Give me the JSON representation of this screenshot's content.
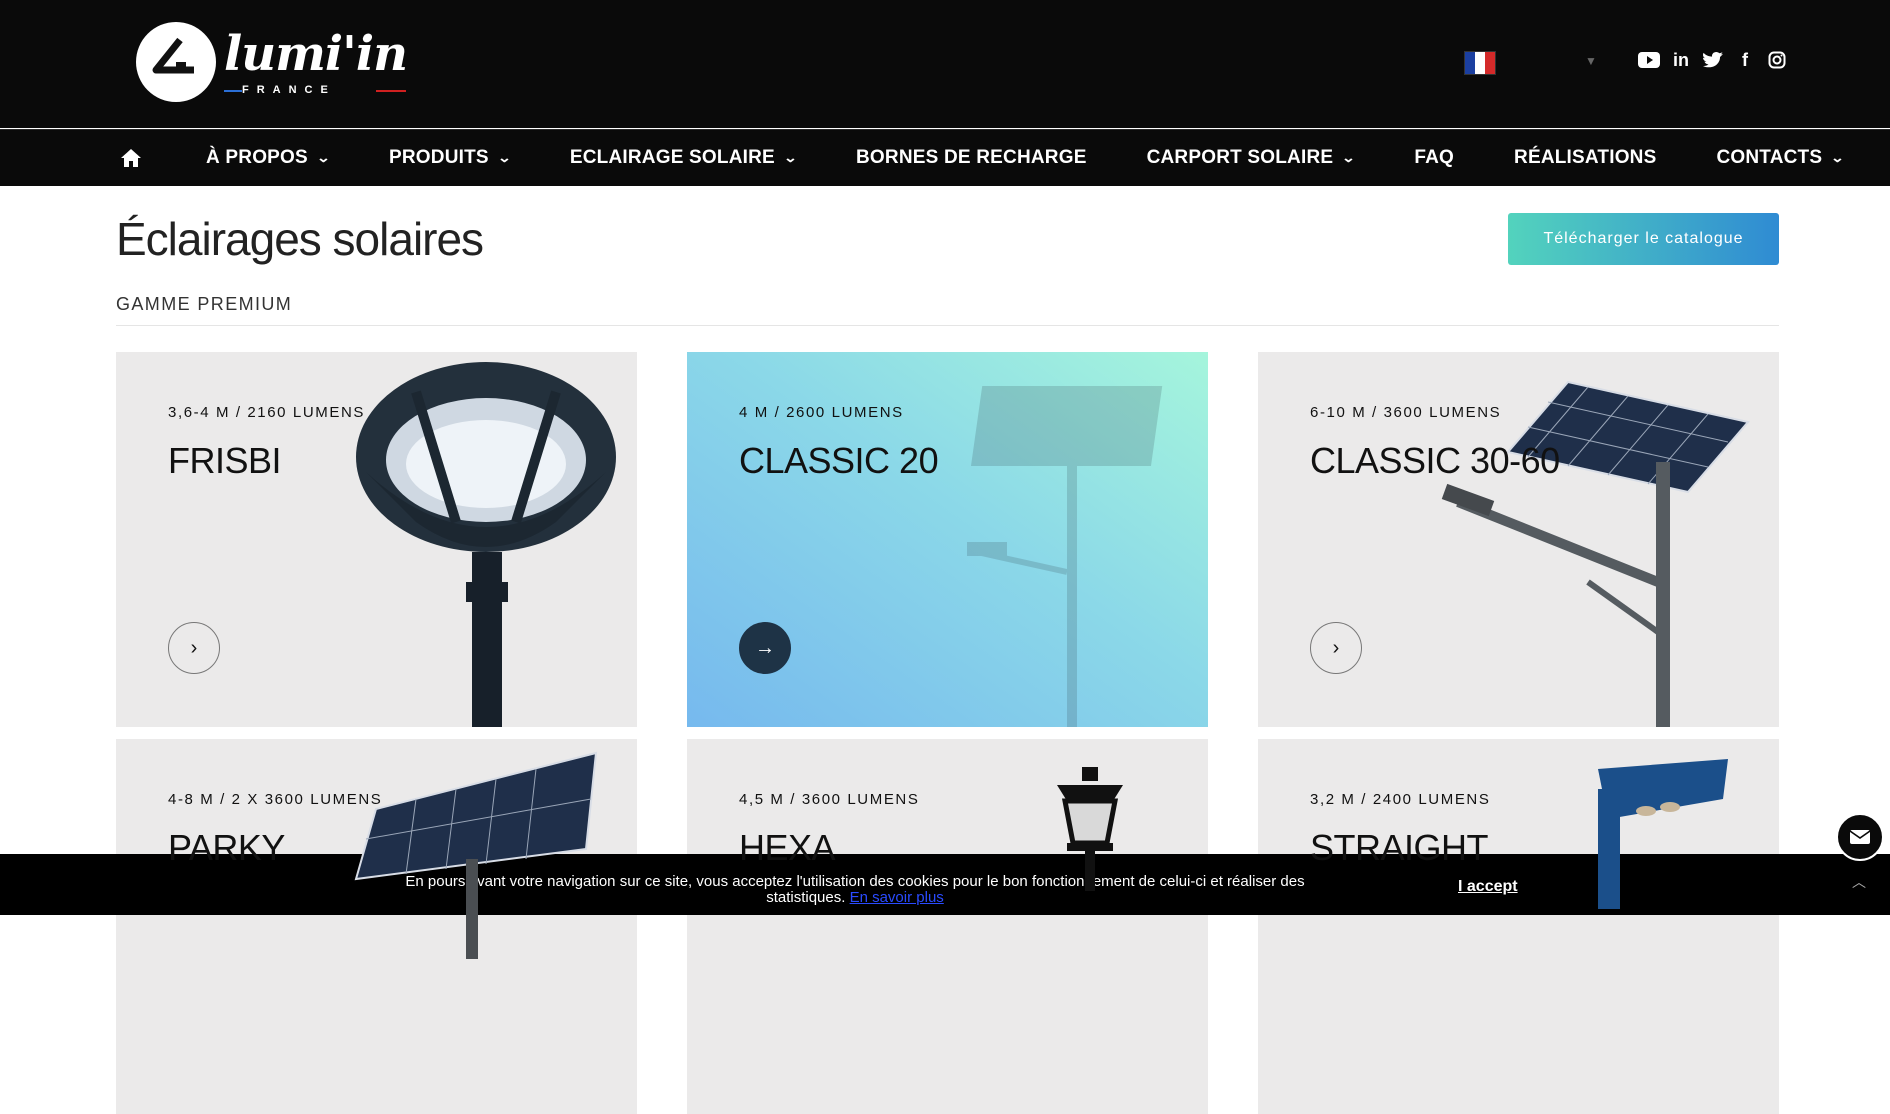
{
  "header": {
    "logo_text": "lumi'in",
    "logo_sub": "FRANCE",
    "language": "FR",
    "social_icons": [
      "youtube-icon",
      "linkedin-icon",
      "twitter-icon",
      "facebook-icon",
      "instagram-icon"
    ]
  },
  "nav": {
    "items": [
      {
        "label": "À PROPOS",
        "dropdown": true
      },
      {
        "label": "PRODUITS",
        "dropdown": true
      },
      {
        "label": "ECLAIRAGE SOLAIRE",
        "dropdown": true
      },
      {
        "label": "BORNES DE RECHARGE",
        "dropdown": false
      },
      {
        "label": "CARPORT SOLAIRE",
        "dropdown": true
      },
      {
        "label": "FAQ",
        "dropdown": false
      },
      {
        "label": "RÉALISATIONS",
        "dropdown": false
      },
      {
        "label": "CONTACTS",
        "dropdown": true
      }
    ]
  },
  "page": {
    "title": "Éclairages solaires",
    "download_label": "Télécharger le catalogue",
    "section": "GAMME PREMIUM"
  },
  "products": [
    {
      "spec": "3,6-4 M / 2160 LUMENS",
      "name": "FRISBI"
    },
    {
      "spec": "4 M / 2600 LUMENS",
      "name": "CLASSIC 20"
    },
    {
      "spec": "6-10 M / 3600 LUMENS",
      "name": "CLASSIC 30-60"
    },
    {
      "spec": "4-8 M / 2 X 3600 LUMENS",
      "name": "PARKY"
    },
    {
      "spec": "4,5 M / 3600 LUMENS",
      "name": "HEXA"
    },
    {
      "spec": "3,2 M / 2400 LUMENS",
      "name": "STRAIGHT"
    }
  ],
  "cookie": {
    "text": "En poursuivant votre navigation sur ce site, vous acceptez l'utilisation des cookies pour le bon fonctionnement de celui-ci et réaliser des statistiques.",
    "link": "En savoir plus",
    "accept": "I accept"
  },
  "colors": {
    "header_bg": "#0a0a0a",
    "button_gradient_start": "#53d3bd",
    "button_gradient_end": "#2f8bd3",
    "card_bg": "#ebeaea"
  }
}
